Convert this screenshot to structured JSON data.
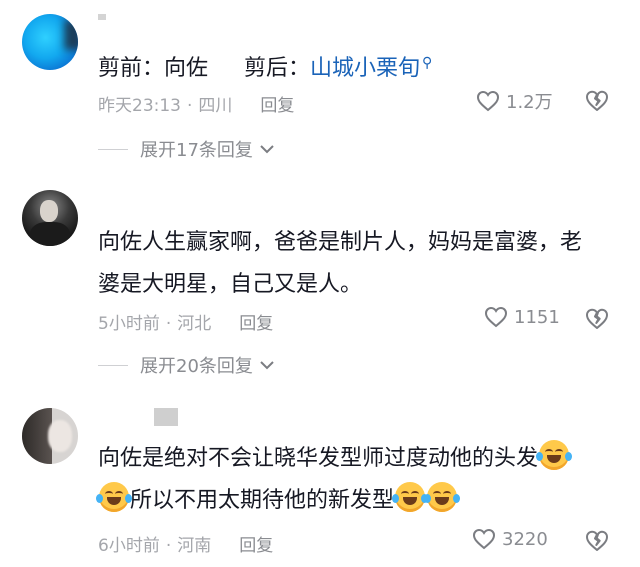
{
  "comments": [
    {
      "text_before": "剪前：向佐",
      "text_after_label": "剪后：",
      "link_text": "山城小栗旬",
      "link_icon": "search-icon",
      "time": "昨天23:13",
      "location": "四川",
      "reply_label": "回复",
      "likes": "1.2万",
      "expand_label": "展开17条回复"
    },
    {
      "line1": "向佐人生赢家啊，爸爸是制片人，妈妈是富婆，老",
      "line2": "婆是大明星，自己又是人。",
      "time": "5小时前",
      "location": "河北",
      "reply_label": "回复",
      "likes": "1151",
      "expand_label": "展开20条回复"
    },
    {
      "line1": "向佐是绝对不会让晓华发型师过度动他的头发",
      "line2": "所以不用太期待他的新发型",
      "emoji": "crying-laughing-emoji",
      "time": "6小时前",
      "location": "河南",
      "reply_label": "回复",
      "likes": "3220"
    }
  ],
  "separator": "·",
  "colors": {
    "link": "#1a63b8",
    "meta": "#a4a6ab",
    "text": "#161823"
  }
}
